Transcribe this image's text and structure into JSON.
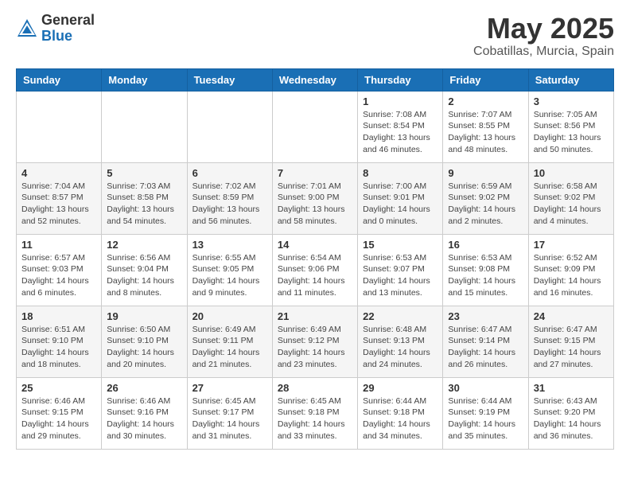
{
  "logo": {
    "general": "General",
    "blue": "Blue"
  },
  "title": {
    "month_year": "May 2025",
    "location": "Cobatillas, Murcia, Spain"
  },
  "days_of_week": [
    "Sunday",
    "Monday",
    "Tuesday",
    "Wednesday",
    "Thursday",
    "Friday",
    "Saturday"
  ],
  "weeks": [
    [
      {
        "day": "",
        "info": ""
      },
      {
        "day": "",
        "info": ""
      },
      {
        "day": "",
        "info": ""
      },
      {
        "day": "",
        "info": ""
      },
      {
        "day": "1",
        "info": "Sunrise: 7:08 AM\nSunset: 8:54 PM\nDaylight: 13 hours\nand 46 minutes."
      },
      {
        "day": "2",
        "info": "Sunrise: 7:07 AM\nSunset: 8:55 PM\nDaylight: 13 hours\nand 48 minutes."
      },
      {
        "day": "3",
        "info": "Sunrise: 7:05 AM\nSunset: 8:56 PM\nDaylight: 13 hours\nand 50 minutes."
      }
    ],
    [
      {
        "day": "4",
        "info": "Sunrise: 7:04 AM\nSunset: 8:57 PM\nDaylight: 13 hours\nand 52 minutes."
      },
      {
        "day": "5",
        "info": "Sunrise: 7:03 AM\nSunset: 8:58 PM\nDaylight: 13 hours\nand 54 minutes."
      },
      {
        "day": "6",
        "info": "Sunrise: 7:02 AM\nSunset: 8:59 PM\nDaylight: 13 hours\nand 56 minutes."
      },
      {
        "day": "7",
        "info": "Sunrise: 7:01 AM\nSunset: 9:00 PM\nDaylight: 13 hours\nand 58 minutes."
      },
      {
        "day": "8",
        "info": "Sunrise: 7:00 AM\nSunset: 9:01 PM\nDaylight: 14 hours\nand 0 minutes."
      },
      {
        "day": "9",
        "info": "Sunrise: 6:59 AM\nSunset: 9:02 PM\nDaylight: 14 hours\nand 2 minutes."
      },
      {
        "day": "10",
        "info": "Sunrise: 6:58 AM\nSunset: 9:02 PM\nDaylight: 14 hours\nand 4 minutes."
      }
    ],
    [
      {
        "day": "11",
        "info": "Sunrise: 6:57 AM\nSunset: 9:03 PM\nDaylight: 14 hours\nand 6 minutes."
      },
      {
        "day": "12",
        "info": "Sunrise: 6:56 AM\nSunset: 9:04 PM\nDaylight: 14 hours\nand 8 minutes."
      },
      {
        "day": "13",
        "info": "Sunrise: 6:55 AM\nSunset: 9:05 PM\nDaylight: 14 hours\nand 9 minutes."
      },
      {
        "day": "14",
        "info": "Sunrise: 6:54 AM\nSunset: 9:06 PM\nDaylight: 14 hours\nand 11 minutes."
      },
      {
        "day": "15",
        "info": "Sunrise: 6:53 AM\nSunset: 9:07 PM\nDaylight: 14 hours\nand 13 minutes."
      },
      {
        "day": "16",
        "info": "Sunrise: 6:53 AM\nSunset: 9:08 PM\nDaylight: 14 hours\nand 15 minutes."
      },
      {
        "day": "17",
        "info": "Sunrise: 6:52 AM\nSunset: 9:09 PM\nDaylight: 14 hours\nand 16 minutes."
      }
    ],
    [
      {
        "day": "18",
        "info": "Sunrise: 6:51 AM\nSunset: 9:10 PM\nDaylight: 14 hours\nand 18 minutes."
      },
      {
        "day": "19",
        "info": "Sunrise: 6:50 AM\nSunset: 9:10 PM\nDaylight: 14 hours\nand 20 minutes."
      },
      {
        "day": "20",
        "info": "Sunrise: 6:49 AM\nSunset: 9:11 PM\nDaylight: 14 hours\nand 21 minutes."
      },
      {
        "day": "21",
        "info": "Sunrise: 6:49 AM\nSunset: 9:12 PM\nDaylight: 14 hours\nand 23 minutes."
      },
      {
        "day": "22",
        "info": "Sunrise: 6:48 AM\nSunset: 9:13 PM\nDaylight: 14 hours\nand 24 minutes."
      },
      {
        "day": "23",
        "info": "Sunrise: 6:47 AM\nSunset: 9:14 PM\nDaylight: 14 hours\nand 26 minutes."
      },
      {
        "day": "24",
        "info": "Sunrise: 6:47 AM\nSunset: 9:15 PM\nDaylight: 14 hours\nand 27 minutes."
      }
    ],
    [
      {
        "day": "25",
        "info": "Sunrise: 6:46 AM\nSunset: 9:15 PM\nDaylight: 14 hours\nand 29 minutes."
      },
      {
        "day": "26",
        "info": "Sunrise: 6:46 AM\nSunset: 9:16 PM\nDaylight: 14 hours\nand 30 minutes."
      },
      {
        "day": "27",
        "info": "Sunrise: 6:45 AM\nSunset: 9:17 PM\nDaylight: 14 hours\nand 31 minutes."
      },
      {
        "day": "28",
        "info": "Sunrise: 6:45 AM\nSunset: 9:18 PM\nDaylight: 14 hours\nand 33 minutes."
      },
      {
        "day": "29",
        "info": "Sunrise: 6:44 AM\nSunset: 9:18 PM\nDaylight: 14 hours\nand 34 minutes."
      },
      {
        "day": "30",
        "info": "Sunrise: 6:44 AM\nSunset: 9:19 PM\nDaylight: 14 hours\nand 35 minutes."
      },
      {
        "day": "31",
        "info": "Sunrise: 6:43 AM\nSunset: 9:20 PM\nDaylight: 14 hours\nand 36 minutes."
      }
    ]
  ]
}
